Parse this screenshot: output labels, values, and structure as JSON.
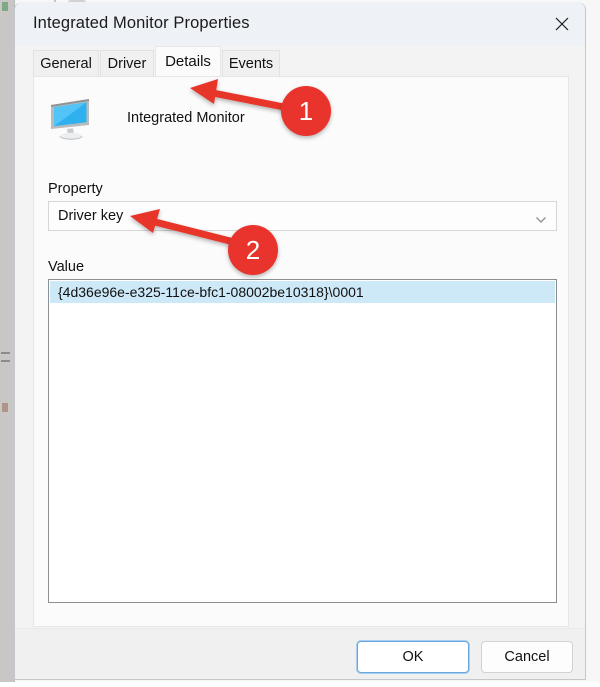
{
  "window": {
    "title": "Integrated Monitor Properties",
    "close_icon": "close-icon"
  },
  "tabs": [
    {
      "label": "General",
      "active": false
    },
    {
      "label": "Driver",
      "active": false
    },
    {
      "label": "Details",
      "active": true
    },
    {
      "label": "Events",
      "active": false
    }
  ],
  "device": {
    "icon": "monitor-icon",
    "name": "Integrated Monitor"
  },
  "property": {
    "label": "Property",
    "selected": "Driver key",
    "dropdown_icon": "chevron-down-icon"
  },
  "value": {
    "label": "Value",
    "rows": [
      "{4d36e96e-e325-11ce-bfc1-08002be10318}\\0001"
    ]
  },
  "buttons": {
    "ok": "OK",
    "cancel": "Cancel"
  },
  "annotations": {
    "badges": [
      {
        "number": "1"
      },
      {
        "number": "2"
      }
    ],
    "color": "#e8342c"
  }
}
